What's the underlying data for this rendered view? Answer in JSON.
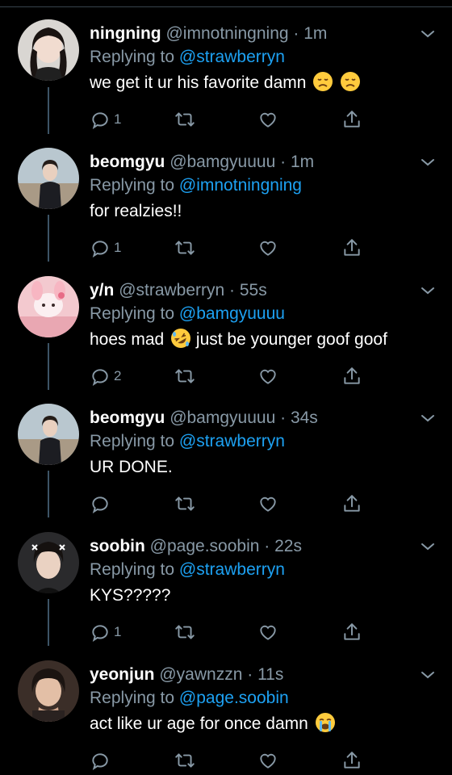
{
  "colors": {
    "background": "#000000",
    "text_primary": "#ffffff",
    "text_secondary": "#8899a6",
    "link": "#1da1f2",
    "thread_line": "#3d5466"
  },
  "reply_prefix": "Replying to",
  "tweets": [
    {
      "name": "ningning",
      "handle": "@imnotningning",
      "time": "1m",
      "reply_to": "@strawberryn",
      "text": "we get it ur his favorite damn",
      "emoji": [
        "disappointed-face",
        "disappointed-face"
      ],
      "reply_count": "1"
    },
    {
      "name": "beomgyu",
      "handle": "@bamgyuuuu",
      "time": "1m",
      "reply_to": "@imnotningning",
      "text": "for realzies!!",
      "emoji": [],
      "reply_count": "1"
    },
    {
      "name": "y/n",
      "handle": "@strawberryn",
      "time": "55s",
      "reply_to": "@bamgyuuuu",
      "text_before": "hoes mad",
      "text_after": "just be younger goof goof",
      "emoji": [
        "rolling-on-floor-laughing-face"
      ],
      "reply_count": "2"
    },
    {
      "name": "beomgyu",
      "handle": "@bamgyuuuu",
      "time": "34s",
      "reply_to": "@strawberryn",
      "text": "UR DONE.",
      "emoji": [],
      "reply_count": ""
    },
    {
      "name": "soobin",
      "handle": "@page.soobin",
      "time": "22s",
      "reply_to": "@strawberryn",
      "text": "KYS?????",
      "emoji": [],
      "reply_count": "1"
    },
    {
      "name": "yeonjun",
      "handle": "@yawnzzn",
      "time": "11s",
      "reply_to": "@page.soobin",
      "text": "act like ur age for once damn",
      "emoji": [
        "loudly-crying-face"
      ],
      "reply_count": ""
    }
  ]
}
